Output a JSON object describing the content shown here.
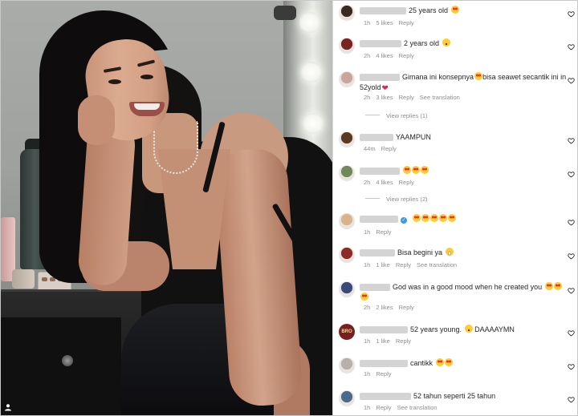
{
  "post": {
    "photo_alt": "",
    "corner_icon": "person-icon"
  },
  "comments": [
    {
      "text_after": "25 years old",
      "emojis": [
        "heart-eyes"
      ],
      "time": "1h",
      "likes": "5 likes",
      "reply": "Reply",
      "avatar_color": "#3b2a22"
    },
    {
      "text_after": "2 years old",
      "emojis": [
        "astonished"
      ],
      "time": "2h",
      "likes": "4 likes",
      "reply": "Reply",
      "avatar_color": "#7a2320"
    },
    {
      "text_after": "Gimana ini konsepnya",
      "text_mid": "bisa seawet secantik ini in",
      "text_line2": "52yold",
      "emojis": [
        "heart-eyes",
        "red-heart"
      ],
      "time": "2h",
      "likes": "3 likes",
      "reply": "Reply",
      "translation": "See translation",
      "view_replies": "View replies (1)",
      "avatar_color": "#c9a59a"
    },
    {
      "text_after": "YAAMPUN",
      "time": "44m",
      "reply": "Reply",
      "avatar_color": "#5a3a22"
    },
    {
      "text_after": "",
      "emojis": [
        "heart-eyes",
        "heart-eyes",
        "heart-eyes"
      ],
      "time": "2h",
      "likes": "4 likes",
      "reply": "Reply",
      "view_replies": "View replies (2)",
      "avatar_color": "#6f8a5a"
    },
    {
      "text_after": "",
      "verified": true,
      "emojis": [
        "heart-eyes",
        "heart-eyes",
        "heart-eyes",
        "heart-eyes",
        "heart-eyes"
      ],
      "time": "1h",
      "reply": "Reply",
      "avatar_color": "#d9b38c"
    },
    {
      "text_after": "Bisa begini ya",
      "emojis": [
        "grin"
      ],
      "time": "1h",
      "likes": "1 like",
      "reply": "Reply",
      "translation": "See translation",
      "avatar_color": "#8c2a2a"
    },
    {
      "text_after": "God was in a good mood when he created you",
      "emojis": [
        "heart-eyes",
        "heart-eyes",
        "heart-eyes"
      ],
      "time": "2h",
      "likes": "2 likes",
      "reply": "Reply",
      "avatar_color": "#3a4a7a"
    },
    {
      "text_after": "52 years young.",
      "text_tail": "DAAAAYMN",
      "emojis": [
        "astonished"
      ],
      "time": "1h",
      "likes": "1 like",
      "reply": "Reply",
      "avatar_color": "#7a1f1f",
      "avatar_text": "BRO"
    },
    {
      "text_after": "cantikk",
      "emojis": [
        "heart-eyes",
        "heart-eyes"
      ],
      "time": "1h",
      "reply": "Reply",
      "avatar_color": "#b8b0a8"
    },
    {
      "text_after": "52 tahun seperti 25 tahun",
      "time": "1h",
      "reply": "Reply",
      "translation": "See translation",
      "avatar_color": "#4a6a8a"
    }
  ],
  "colors": {
    "text": "#262626",
    "meta": "#8e8e8e",
    "verified": "#3897f0"
  }
}
